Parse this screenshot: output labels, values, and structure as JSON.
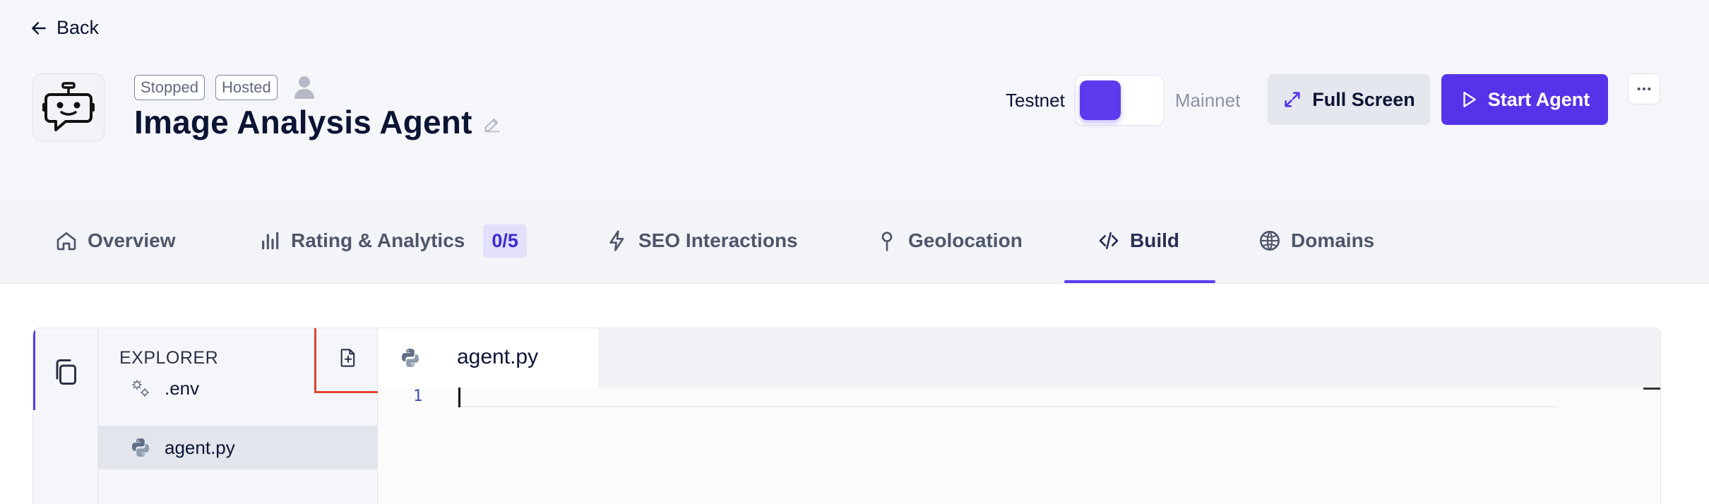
{
  "nav": {
    "back_label": "Back"
  },
  "agent": {
    "status_badge": "Stopped",
    "hosting_badge": "Hosted",
    "title": "Image Analysis Agent"
  },
  "network": {
    "testnet_label": "Testnet",
    "mainnet_label": "Mainnet",
    "selected": "Testnet"
  },
  "actions": {
    "full_screen_label": "Full Screen",
    "start_label": "Start Agent"
  },
  "tabs": [
    {
      "label": "Overview",
      "icon": "home-icon"
    },
    {
      "label": "Rating & Analytics",
      "icon": "bar-chart-icon",
      "count": "0/5"
    },
    {
      "label": "SEO Interactions",
      "icon": "lightning-icon"
    },
    {
      "label": "Geolocation",
      "icon": "pin-icon"
    },
    {
      "label": "Build",
      "icon": "code-icon",
      "active": true
    },
    {
      "label": "Domains",
      "icon": "globe-icon"
    }
  ],
  "ide": {
    "explorer_title": "EXPLORER",
    "files": [
      {
        "name": ".env",
        "icon": "gears-icon"
      },
      {
        "name": "agent.py",
        "icon": "python-icon",
        "selected": true
      }
    ],
    "open_tab": "agent.py",
    "line_numbers": [
      "1"
    ]
  },
  "colors": {
    "accent": "#5533e8",
    "highlight_box": "#e0442f"
  }
}
